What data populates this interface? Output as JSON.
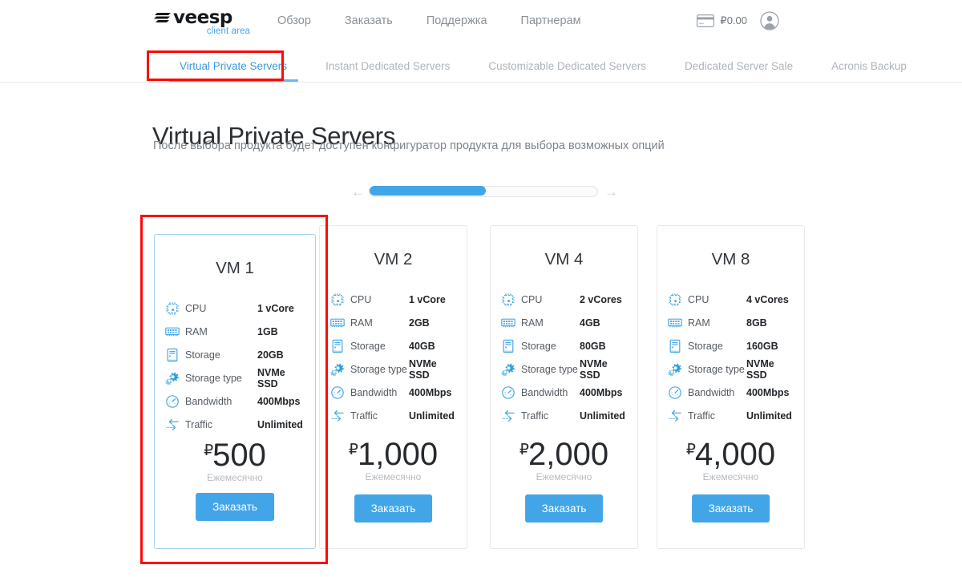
{
  "header": {
    "logo": {
      "word": "veesp",
      "sub": "client area",
      "icon": "veesp-bars-logo"
    },
    "nav": [
      {
        "label": "Обзор"
      },
      {
        "label": "Заказать"
      },
      {
        "label": "Поддержка"
      },
      {
        "label": "Партнерам"
      }
    ],
    "balance": {
      "amount": "₽0.00",
      "icon": "credit-card-icon"
    },
    "account": {
      "icon": "user-avatar-icon"
    }
  },
  "tabs": [
    {
      "label": "Virtual Private Servers",
      "active": true
    },
    {
      "label": "Instant Dedicated Servers",
      "active": false
    },
    {
      "label": "Customizable Dedicated Servers",
      "active": false
    },
    {
      "label": "Dedicated Server Sale",
      "active": false
    },
    {
      "label": "Acronis Backup",
      "active": false
    }
  ],
  "main": {
    "title": "Virtual Private Servers",
    "subtitle": "После выбора продукта будет доступен конфигуратор продукта для выбора возможных опций"
  },
  "slider": {
    "left_arrow": "←",
    "right_arrow": "→",
    "fill_percent": 51
  },
  "spec_labels": {
    "cpu": "CPU",
    "ram": "RAM",
    "storage": "Storage",
    "storage_type": "Storage type",
    "bandwidth": "Bandwidth",
    "traffic": "Traffic"
  },
  "cards": [
    {
      "title": "VM 1",
      "selected": true,
      "specs": {
        "cpu": "1 vCore",
        "ram": "1GB",
        "storage": "20GB",
        "storage_type": "NVMe SSD",
        "bandwidth": "400Mbps",
        "traffic": "Unlimited"
      },
      "currency": "₽",
      "price": "500",
      "period": "Ежемесячно",
      "order_label": "Заказать"
    },
    {
      "title": "VM 2",
      "selected": false,
      "specs": {
        "cpu": "1 vCore",
        "ram": "2GB",
        "storage": "40GB",
        "storage_type": "NVMe SSD",
        "bandwidth": "400Mbps",
        "traffic": "Unlimited"
      },
      "currency": "₽",
      "price": "1,000",
      "period": "Ежемесячно",
      "order_label": "Заказать"
    },
    {
      "title": "VM 4",
      "selected": false,
      "specs": {
        "cpu": "2 vCores",
        "ram": "4GB",
        "storage": "80GB",
        "storage_type": "NVMe SSD",
        "bandwidth": "400Mbps",
        "traffic": "Unlimited"
      },
      "currency": "₽",
      "price": "2,000",
      "period": "Ежемесячно",
      "order_label": "Заказать"
    },
    {
      "title": "VM 8",
      "selected": false,
      "specs": {
        "cpu": "4 vCores",
        "ram": "8GB",
        "storage": "160GB",
        "storage_type": "NVMe SSD",
        "bandwidth": "400Mbps",
        "traffic": "Unlimited"
      },
      "currency": "₽",
      "price": "4,000",
      "period": "Ежемесячно",
      "order_label": "Заказать"
    }
  ],
  "annotations": [
    {
      "name": "tab-highlight",
      "color": "#fb0a0a"
    },
    {
      "name": "card-highlight",
      "color": "#fb0a0a"
    }
  ],
  "colors": {
    "accent": "#42a5e8",
    "tab_active": "#3a9ae0",
    "annotation": "#fb0a0a",
    "icon_blue": "#4aa9e8",
    "muted_text": "#8a9199"
  }
}
